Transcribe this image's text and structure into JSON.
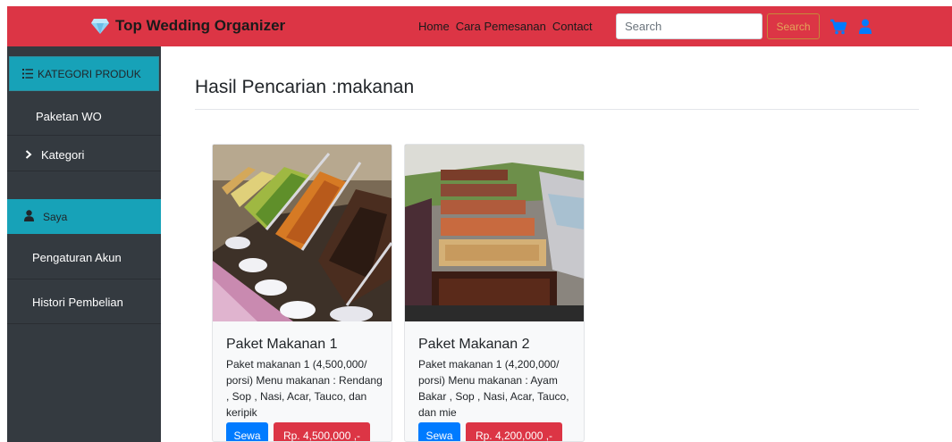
{
  "navbar": {
    "brand": "Top Wedding Organizer",
    "links": [
      "Home",
      "Cara Pemesanan",
      "Contact"
    ],
    "search_placeholder": "Search",
    "search_button": "Search",
    "colors": {
      "navbar_bg": "#dc3545",
      "icon_blue": "#007bff",
      "diamond": "#8fd3f4"
    }
  },
  "sidebar": {
    "header": "KATEGORI PRODUK",
    "items": [
      "Paketan WO",
      "Kategori"
    ],
    "account_header": "Saya",
    "account_items": [
      "Pengaturan Akun",
      "Histori Pembelian"
    ],
    "colors": {
      "bg": "#343a40",
      "accent": "#17a2b8"
    }
  },
  "main": {
    "title": "Hasil Pencarian :makanan",
    "products": [
      {
        "title": "Paket Makanan 1",
        "description": "Paket makanan 1 (4,500,000/ porsi) Menu makanan : Rendang , Sop , Nasi, Acar, Tauco, dan keripik",
        "rent_label": "Sewa",
        "price": "Rp. 4,500,000 ,-"
      },
      {
        "title": "Paket Makanan 2",
        "description": "Paket makanan 1 (4,200,000/ porsi) Menu makanan : Ayam Bakar , Sop , Nasi, Acar, Tauco, dan mie",
        "rent_label": "Sewa",
        "price": "Rp. 4,200,000 ,-"
      }
    ]
  },
  "icons": {
    "brand": "diamond-icon",
    "cart": "cart-icon",
    "user": "user-icon",
    "category_list": "list-icon",
    "expand": "chevron-right-icon",
    "account": "user-icon"
  }
}
